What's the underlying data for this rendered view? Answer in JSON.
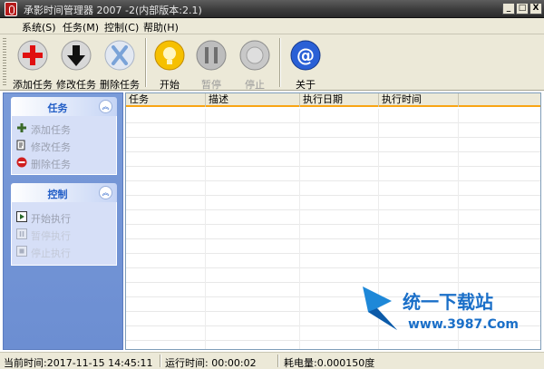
{
  "window": {
    "title": "承影时间管理器 2007 -2(内部版本:2.1)",
    "buttons": [
      "_",
      "□",
      "X"
    ]
  },
  "menu": [
    "系统(S)",
    "任务(M)",
    "控制(C)",
    "帮助(H)"
  ],
  "toolbar": {
    "add_task": "添加任务",
    "edit_task": "修改任务",
    "delete_task": "删除任务",
    "start": "开始",
    "pause": "暂停",
    "stop": "停止",
    "about": "关于"
  },
  "sidebar": {
    "task_group": {
      "title": "任务",
      "items": [
        "添加任务",
        "修改任务",
        "删除任务"
      ]
    },
    "control_group": {
      "title": "控制",
      "items": [
        "开始执行",
        "暂停执行",
        "停止执行"
      ]
    }
  },
  "grid": {
    "columns": [
      "任务",
      "描述",
      "执行日期",
      "执行时间"
    ]
  },
  "watermark": {
    "name": "统一下载站",
    "url": "www.3987.Com"
  },
  "status": {
    "current_time": "当前时间:2017-11-15 14:45:11",
    "run_time": "运行时间: 00:00:02",
    "power": "耗电量:0.000150度"
  },
  "colors": {
    "accent": "#f9a514",
    "panel_blue": "#6c8ed2",
    "link_blue": "#215dc6"
  }
}
